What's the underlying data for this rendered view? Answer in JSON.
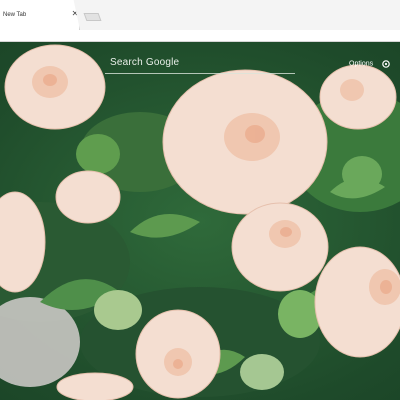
{
  "browser": {
    "tabs": [
      {
        "title": "New Tab",
        "active": true
      }
    ],
    "close_icon": "close-icon",
    "new_tab_icon": "new-tab-button"
  },
  "newtab": {
    "search": {
      "placeholder": "Search Google"
    },
    "options": {
      "label": "Options",
      "icon": "gear-icon"
    },
    "background": {
      "subject": "rose-bouquet-image",
      "accent": "#f6dccb"
    }
  }
}
